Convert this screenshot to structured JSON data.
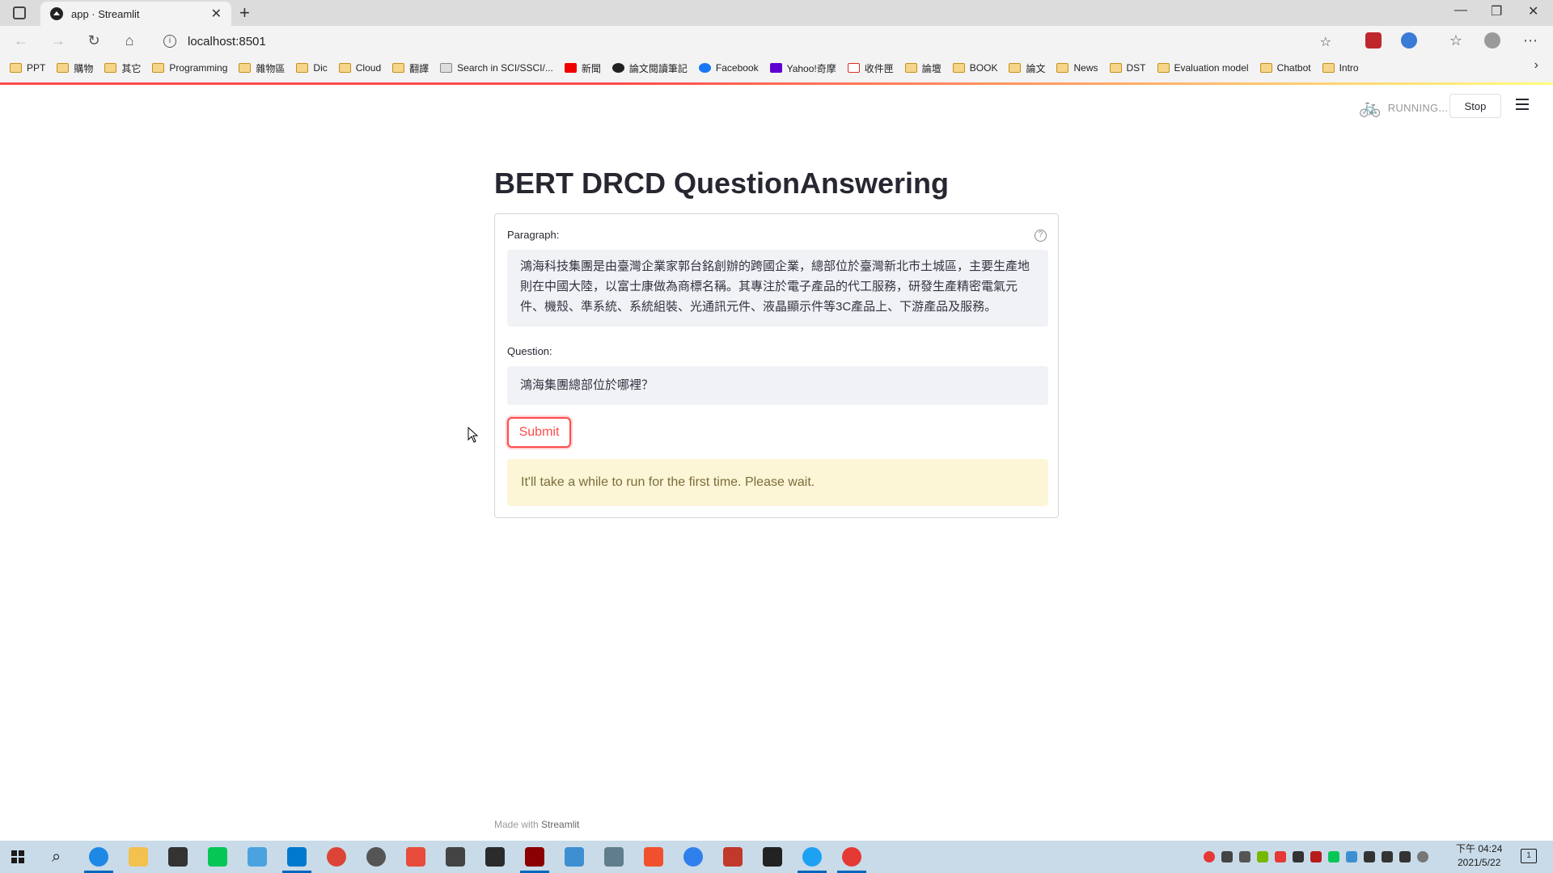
{
  "browser": {
    "tab_title": "app · Streamlit",
    "tab_close": "✕",
    "new_tab": "+",
    "url": "localhost:8501",
    "bookmarks": [
      "PPT",
      "購物",
      "其它",
      "Programming",
      "雜物區",
      "Dic",
      "Cloud",
      "翻譯",
      "Search in SCI/SSCI/...",
      "新聞",
      "論文閱讀筆記",
      "Facebook",
      "Yahoo!奇摩",
      "收件匣",
      "論壇",
      "BOOK",
      "論文",
      "News",
      "DST",
      "Evaluation model",
      "Chatbot",
      "Intro"
    ],
    "bookmarks_more": "›"
  },
  "status": {
    "running": "RUNNING...",
    "stop_label": "Stop"
  },
  "app": {
    "title": "BERT DRCD QuestionAnswering",
    "paragraph_label": "Paragraph:",
    "help": "?",
    "paragraph_value": "鴻海科技集團是由臺灣企業家郭台銘創辦的跨國企業，總部位於臺灣新北市土城區，主要生產地則在中國大陸，以富士康做為商標名稱。其專注於電子產品的代工服務，研發生產精密電氣元件、機殼、準系統、系統組裝、光通訊元件、液晶顯示件等3C產品上、下游產品及服務。",
    "question_label": "Question:",
    "question_value": "鴻海集團總部位於哪裡？",
    "submit_label": "Submit",
    "warning": "It'll take a while to run for the first time. Please wait."
  },
  "footer": {
    "made_with": "Made with",
    "brand": "Streamlit"
  },
  "taskbar": {
    "time": "下午 04:24",
    "date": "2021/5/22",
    "notifications": "1"
  },
  "colors": {
    "accent": "#ff4b4b",
    "warning_bg": "#fcf5d6",
    "input_bg": "#f0f2f6"
  }
}
